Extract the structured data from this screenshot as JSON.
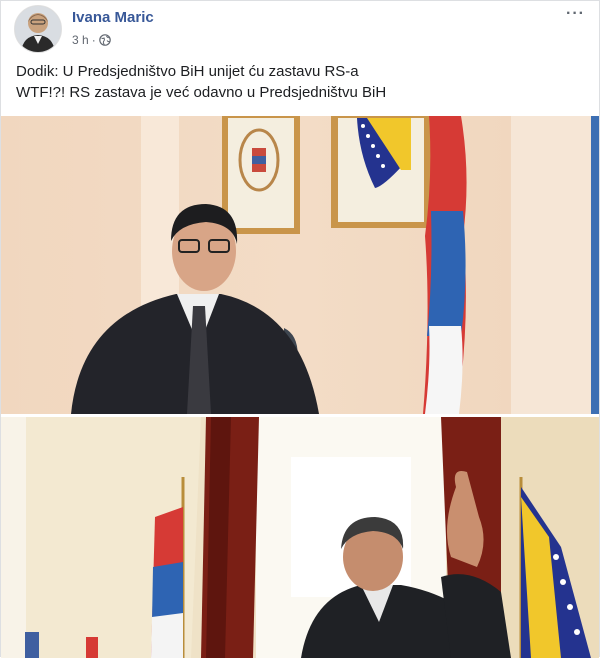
{
  "post": {
    "author": "Ivana Maric",
    "timestamp": "3 h",
    "separator": "·",
    "audience_icon": "globe-icon",
    "more_icon": "more-options-icon",
    "more_label": "···",
    "text_lines": [
      "Dodik: U Predsjedništvo BiH unijet ću zastavu RS-a",
      "WTF!?! RS zastava je već odavno u Predsjedništvu BiH"
    ]
  },
  "colors": {
    "author_link": "#385898",
    "meta_text": "#616770",
    "body_text": "#1c1e21"
  }
}
